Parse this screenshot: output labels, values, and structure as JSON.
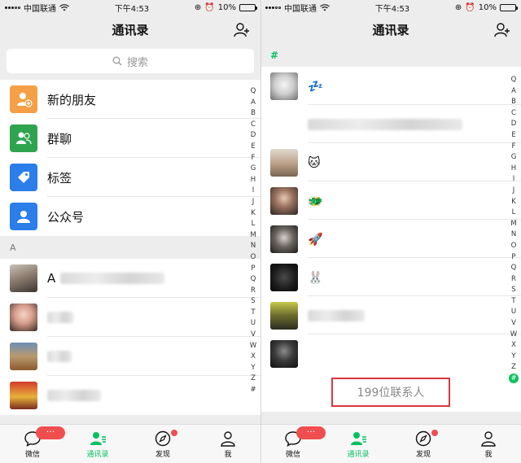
{
  "status": {
    "carrier": "中国联通",
    "time": "下午4:53",
    "battery": "10%",
    "battery_level": 0.1
  },
  "nav": {
    "title": "通讯录"
  },
  "search": {
    "placeholder": "搜索"
  },
  "functions": [
    {
      "label": "新的朋友",
      "icon": "new-friend-icon",
      "color": "#f5a046"
    },
    {
      "label": "群聊",
      "icon": "group-chat-icon",
      "color": "#2ea44f"
    },
    {
      "label": "标签",
      "icon": "tag-icon",
      "color": "#2b7de9"
    },
    {
      "label": "公众号",
      "icon": "official-account-icon",
      "color": "#2b7de9"
    }
  ],
  "left_section": {
    "header": "A",
    "contacts": [
      {
        "initial": "A"
      },
      {},
      {},
      {}
    ]
  },
  "right_section": {
    "header": "#",
    "contacts": [
      {
        "display": "💤"
      },
      {},
      {
        "display": "🐱"
      },
      {
        "display": "🐲"
      },
      {
        "display": "🚀"
      },
      {
        "display": "🐰"
      },
      {},
      {}
    ],
    "count": "199位联系人"
  },
  "index_letters": [
    "Q",
    "A",
    "B",
    "C",
    "D",
    "E",
    "F",
    "G",
    "H",
    "I",
    "J",
    "K",
    "L",
    "M",
    "N",
    "O",
    "P",
    "Q",
    "R",
    "S",
    "T",
    "U",
    "V",
    "W",
    "X",
    "Y",
    "Z",
    "#"
  ],
  "tabs": [
    {
      "label": "微信",
      "icon": "chat-bubble-icon"
    },
    {
      "label": "通讯录",
      "icon": "contacts-icon"
    },
    {
      "label": "发现",
      "icon": "compass-icon"
    },
    {
      "label": "我",
      "icon": "person-icon"
    }
  ],
  "colors": {
    "accent": "#07c160",
    "badge": "#f04e4e",
    "highlight_border": "#d9373f"
  }
}
